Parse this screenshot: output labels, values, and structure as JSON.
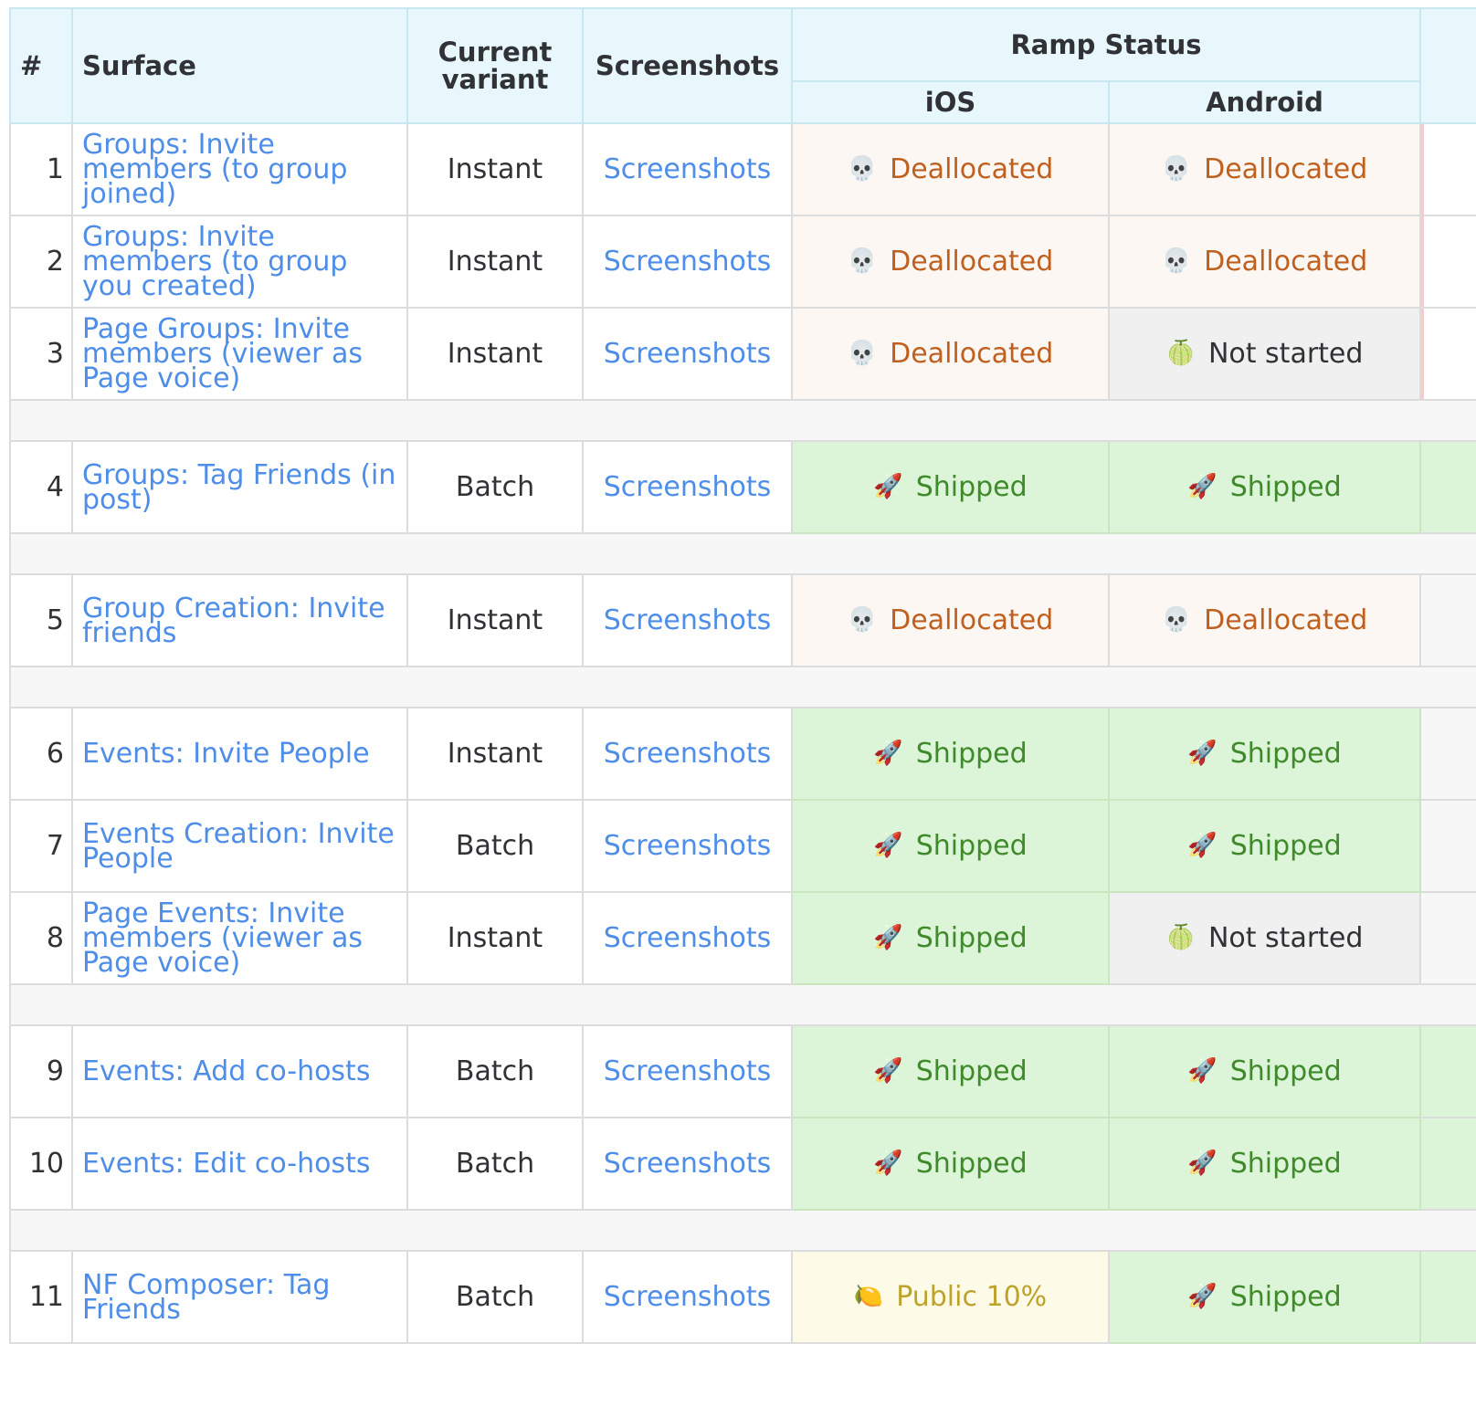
{
  "header": {
    "hash": "#",
    "surface": "Surface",
    "current_variant": "Current variant",
    "screenshots": "Screenshots",
    "ramp_status": "Ramp Status",
    "ios": "iOS",
    "android": "Android"
  },
  "status_icons": {
    "Deallocated": "💀",
    "Shipped": "🚀",
    "Not started": "🍈",
    "Public 10%": "🍋"
  },
  "rows": [
    {
      "num": "1",
      "surface": "Groups: Invite members (to group joined)",
      "variant": "Instant",
      "screenshots": "Screenshots",
      "ios": "Deallocated",
      "android": "Deallocated",
      "ios_icon": "💀",
      "android_icon": "💀"
    },
    {
      "num": "2",
      "surface": "Groups: Invite members (to group you created)",
      "variant": "Instant",
      "screenshots": "Screenshots",
      "ios": "Deallocated",
      "android": "Deallocated",
      "ios_icon": "💀",
      "android_icon": "💀"
    },
    {
      "num": "3",
      "surface": "Page Groups: Invite members (viewer as Page voice)",
      "variant": "Instant",
      "screenshots": "Screenshots",
      "ios": "Deallocated",
      "android": "Not started",
      "ios_icon": "💀",
      "android_icon": "🍈"
    },
    {
      "num": "4",
      "surface": "Groups: Tag Friends (in post)",
      "variant": "Batch",
      "screenshots": "Screenshots",
      "ios": "Shipped",
      "android": "Shipped",
      "ios_icon": "🚀",
      "android_icon": "🚀"
    },
    {
      "num": "5",
      "surface": "Group Creation: Invite friends",
      "variant": "Instant",
      "screenshots": "Screenshots",
      "ios": "Deallocated",
      "android": "Deallocated",
      "ios_icon": "💀",
      "android_icon": "💀"
    },
    {
      "num": "6",
      "surface": "Events: Invite People",
      "variant": "Instant",
      "screenshots": "Screenshots",
      "ios": "Shipped",
      "android": "Shipped",
      "ios_icon": "🚀",
      "android_icon": "🚀"
    },
    {
      "num": "7",
      "surface": "Events Creation: Invite People",
      "variant": "Batch",
      "screenshots": "Screenshots",
      "ios": "Shipped",
      "android": "Shipped",
      "ios_icon": "🚀",
      "android_icon": "🚀"
    },
    {
      "num": "8",
      "surface": "Page Events: Invite members (viewer as Page voice)",
      "variant": "Instant",
      "screenshots": "Screenshots",
      "ios": "Shipped",
      "android": "Not started",
      "ios_icon": "🚀",
      "android_icon": "🍈"
    },
    {
      "num": "9",
      "surface": "Events: Add co-hosts",
      "variant": "Batch",
      "screenshots": "Screenshots",
      "ios": "Shipped",
      "android": "Shipped",
      "ios_icon": "🚀",
      "android_icon": "🚀"
    },
    {
      "num": "10",
      "surface": "Events: Edit co-hosts",
      "variant": "Batch",
      "screenshots": "Screenshots",
      "ios": "Shipped",
      "android": "Shipped",
      "ios_icon": "🚀",
      "android_icon": "🚀"
    },
    {
      "num": "11",
      "surface": "NF Composer: Tag Friends",
      "variant": "Batch",
      "screenshots": "Screenshots",
      "ios": "Public 10%",
      "android": "Shipped",
      "ios_icon": "🍋",
      "android_icon": "🚀"
    }
  ],
  "colors": {
    "header_bg": "#e8f7fc",
    "link": "#4e8de8",
    "deallocated_text": "#c0601f",
    "deallocated_bg": "#fdf7f3",
    "shipped_text": "#3f8a2a",
    "shipped_bg": "#dcf4d7",
    "not_started_bg": "#f0f0f0",
    "public_text": "#bfa22c",
    "public_bg": "#fdfbe8"
  }
}
